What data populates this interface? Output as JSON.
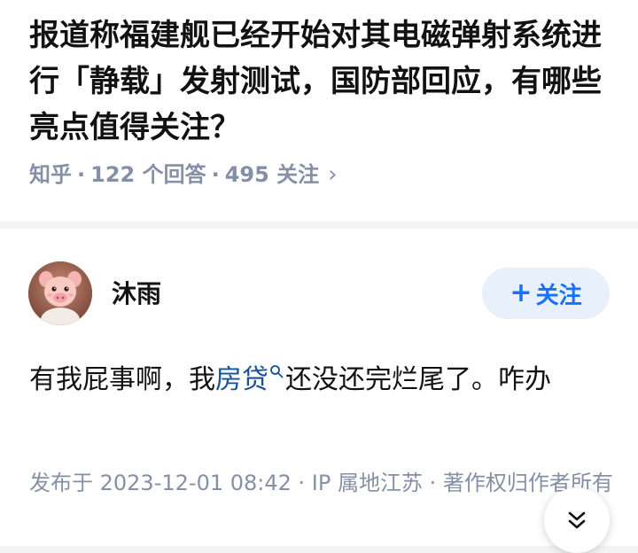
{
  "question": {
    "title": "报道称福建舰已经开始对其电磁弹射系统进行「静载」发射测试，国防部回应，有哪些亮点值得关注？",
    "meta": {
      "source": "知乎",
      "answers": "122 个回答",
      "followers": "495 关注",
      "separator": "·",
      "chevron": "›"
    }
  },
  "answer": {
    "author": {
      "name": "沐雨",
      "avatar_icon": "pig-avatar-icon"
    },
    "follow_button": {
      "plus": "+",
      "label": "关注"
    },
    "content": {
      "before": "有我屁事啊，我",
      "keyword": "房贷",
      "after": "还没还完烂尾了。咋办"
    },
    "footer": "发布于 2023-12-01 08:42 · IP 属地江苏 · 著作权归作者所有"
  },
  "colors": {
    "accent": "#1772f6",
    "link": "#175199",
    "meta_gray": "#8590a6",
    "follow_bg": "#e8f0fb"
  }
}
